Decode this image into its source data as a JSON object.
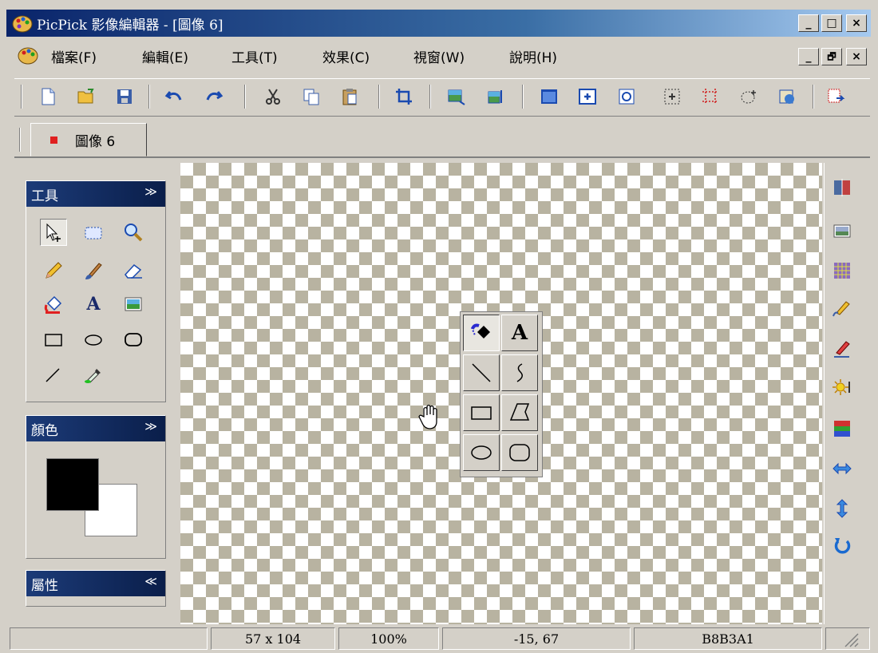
{
  "window": {
    "title": "PicPick 影像編輯器 - [圖像 6]",
    "minimize_glyph": "_",
    "maximize_glyph": "□",
    "close_glyph": "×",
    "restore_glyph": "🗗"
  },
  "menu": {
    "items": [
      "檔案(F)",
      "編輯(E)",
      "工具(T)",
      "效果(C)",
      "視窗(W)",
      "說明(H)"
    ]
  },
  "document_tab": {
    "label": "圖像 6"
  },
  "panels": {
    "tools": {
      "title": "工具",
      "chevron": "≫"
    },
    "color": {
      "title": "顏色",
      "chevron": "≫",
      "foreground": "#000000",
      "background": "#ffffff"
    },
    "properties": {
      "title": "屬性",
      "chevron": "≪"
    }
  },
  "popup_palette": {
    "text_tool_glyph": "A"
  },
  "status_bar": {
    "cell1": "",
    "size": "57 x 104",
    "zoom": "100%",
    "position": "-15, 67",
    "color_hex": "B8B3A1"
  },
  "colors": {
    "titlebar_start": "#0a246a",
    "panel_header": "#0a1e4a",
    "checker_light": "#ffffff",
    "checker_dark": "#b8b3a1"
  }
}
